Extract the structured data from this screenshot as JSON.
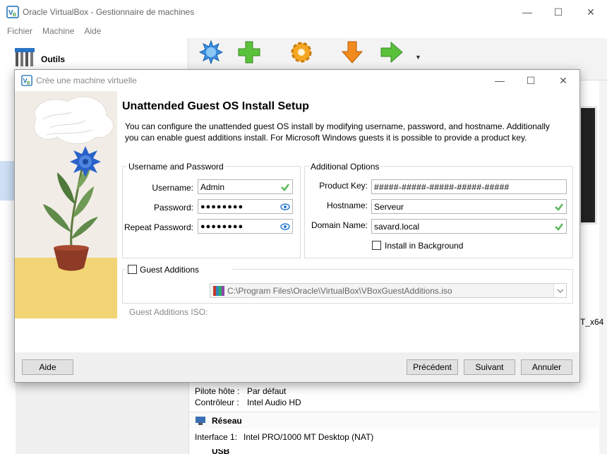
{
  "main_window": {
    "title": "Oracle VirtualBox - Gestionnaire de machines",
    "controls": {
      "minimize": "—",
      "maximize": "☐",
      "close": "✕"
    },
    "menu": [
      "Fichier",
      "Machine",
      "Aide"
    ],
    "tools_label": "Outils",
    "toolbar": {
      "new": "Nouvelle",
      "add": "Ajouter",
      "settings": "Configuration",
      "discard": "Oublier",
      "start": "Démarrer"
    },
    "details": {
      "os_fragment": "T_x64",
      "audio_host_label": "Pilote hôte :",
      "audio_host_value": "Par défaut",
      "audio_controller_label": "Contrôleur :",
      "audio_controller_value": "Intel Audio HD",
      "network_heading": "Réseau",
      "interface_label": "Interface 1:",
      "interface_value": "Intel PRO/1000 MT Desktop (NAT)",
      "usb_heading": "USB"
    }
  },
  "dialog": {
    "title": "Crée une machine virtuelle",
    "controls": {
      "minimize": "—",
      "maximize": "☐",
      "close": "✕"
    },
    "heading": "Unattended Guest OS Install Setup",
    "description": "You can configure the unattended guest OS install by modifying username, password, and hostname. Additionally you can enable guest additions install. For Microsoft Windows guests it is possible to provide a product key.",
    "user_group": {
      "title": "Username and Password",
      "username_label": "Username:",
      "username_value": "Admin",
      "password_label": "Password:",
      "password_value": "●●●●●●●●",
      "repeat_label": "Repeat Password:",
      "repeat_value": "●●●●●●●●"
    },
    "options_group": {
      "title": "Additional Options",
      "product_key_label": "Product Key:",
      "product_key_value": "#####-#####-#####-#####-#####",
      "hostname_label": "Hostname:",
      "hostname_value": "Serveur",
      "domain_label": "Domain Name:",
      "domain_value": "savard.local",
      "background_label": "Install in Background",
      "background_checked": false
    },
    "guest_additions": {
      "label": "Guest Additions",
      "checked": false,
      "iso_label": "Guest Additions ISO:",
      "iso_value": "C:\\Program Files\\Oracle\\VirtualBox\\VBoxGuestAdditions.iso"
    },
    "buttons": {
      "help": "Aide",
      "previous": "Précédent",
      "next": "Suivant",
      "cancel": "Annuler"
    }
  },
  "colors": {
    "valid_green": "#5cb85c",
    "selection_blue": "#cde0f5",
    "art_yellow": "#f1d474"
  },
  "icons": [
    "virtualbox-logo-icon",
    "tools-icon",
    "new-vm-icon",
    "add-vm-icon",
    "settings-gear-icon",
    "discard-arrow-icon",
    "start-arrow-icon",
    "check-icon",
    "eye-icon",
    "iso-disk-icon",
    "chevron-down-icon",
    "network-icon"
  ]
}
